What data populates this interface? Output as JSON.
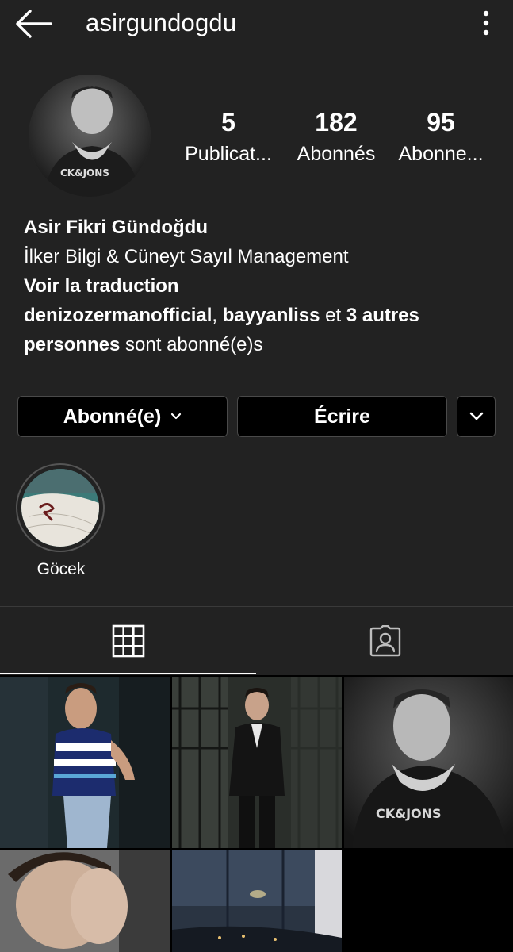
{
  "header": {
    "username": "asirgundogdu",
    "back_icon": "arrow-left-icon",
    "more_icon": "vertical-ellipsis-icon"
  },
  "stats": {
    "posts": {
      "count": "5",
      "label": "Publicat..."
    },
    "followers": {
      "count": "182",
      "label": "Abonnés"
    },
    "following": {
      "count": "95",
      "label": "Abonne..."
    }
  },
  "bio": {
    "name": "Asir Fikri Gündoğdu",
    "description": "İlker Bilgi & Cüneyt Sayıl Management",
    "translate": "Voir la traduction",
    "followed_by": {
      "user1": "denizozermanofficial",
      "sep": ", ",
      "user2": "bayyanliss",
      "and": " et ",
      "others": "3 autres personnes",
      "suffix": " sont abonné(e)s"
    }
  },
  "actions": {
    "follow_label": "Abonné(e)",
    "message_label": "Écrire"
  },
  "highlights": [
    {
      "label": "Göcek"
    }
  ],
  "tabs": [
    {
      "name": "grid",
      "icon": "grid-icon",
      "active": true
    },
    {
      "name": "tagged",
      "icon": "tagged-person-icon",
      "active": false
    }
  ],
  "colors": {
    "background": "#222222",
    "button_bg": "#000000",
    "button_border": "#4a4a4a",
    "text": "#ffffff"
  }
}
